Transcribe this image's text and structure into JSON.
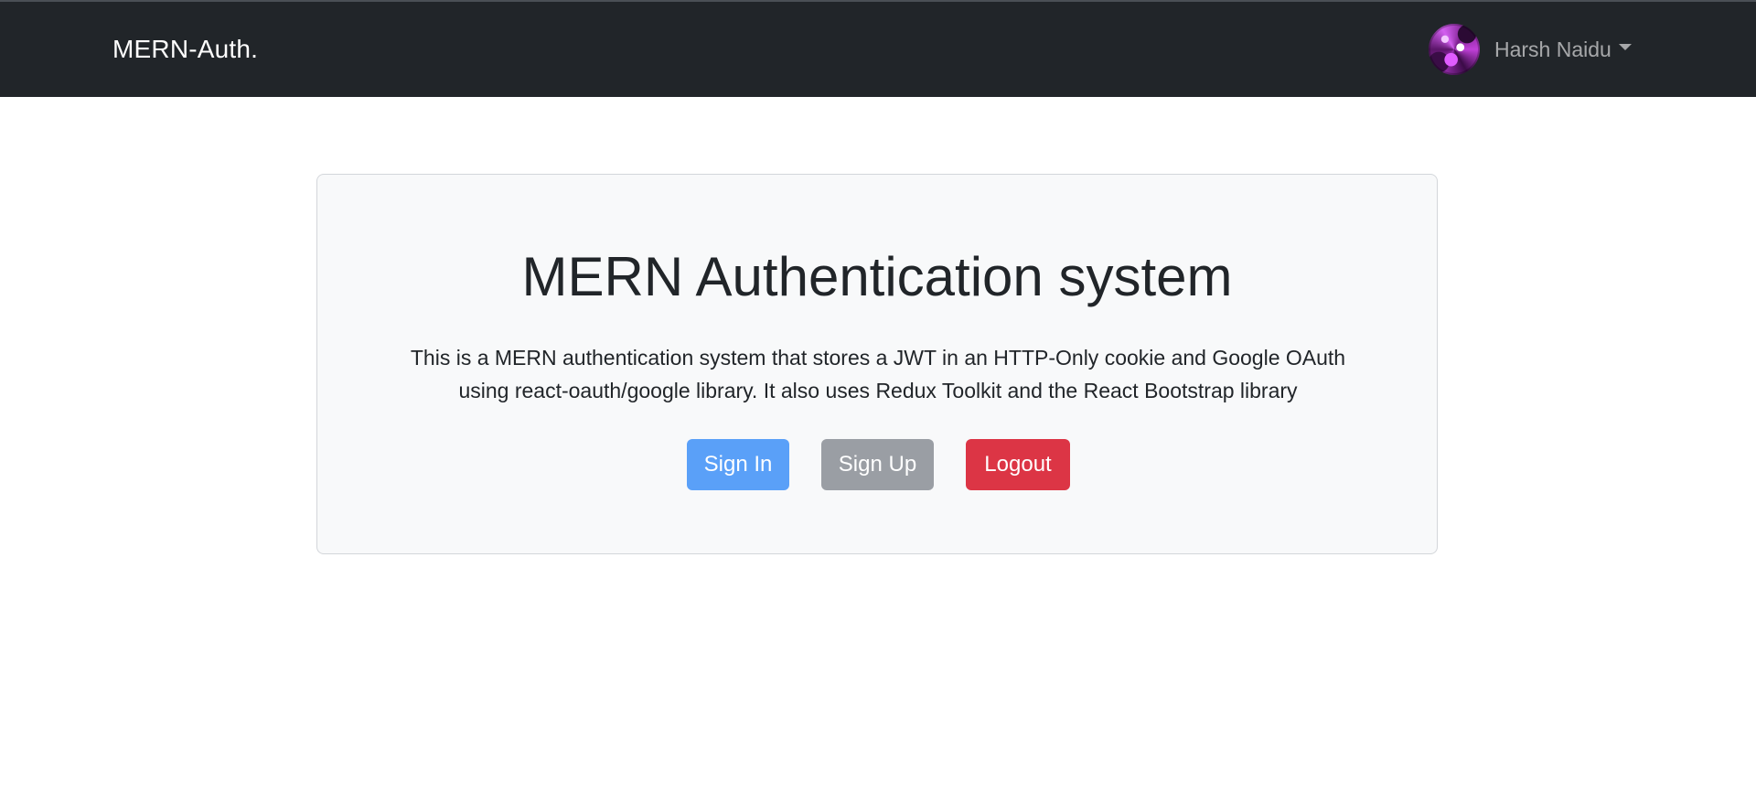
{
  "navbar": {
    "brand": "MERN-Auth.",
    "user": {
      "name": "Harsh Naidu",
      "avatar_icon": "profile-photo"
    },
    "background": "#212529"
  },
  "hero": {
    "title": "MERN Authentication system",
    "description_line1": "This is a MERN authentication system that stores a JWT in an HTTP-Only cookie and Google OAuth",
    "description_line2": "using react-oauth/google library. It also uses Redux Toolkit and the React Bootstrap library",
    "background": "#f8f9fa",
    "buttons": {
      "sign_in": "Sign In",
      "sign_up": "Sign Up",
      "logout": "Logout"
    },
    "colors": {
      "sign_in": "#5aa0f8",
      "sign_up": "#9a9ea4",
      "logout": "#dc3545"
    }
  }
}
